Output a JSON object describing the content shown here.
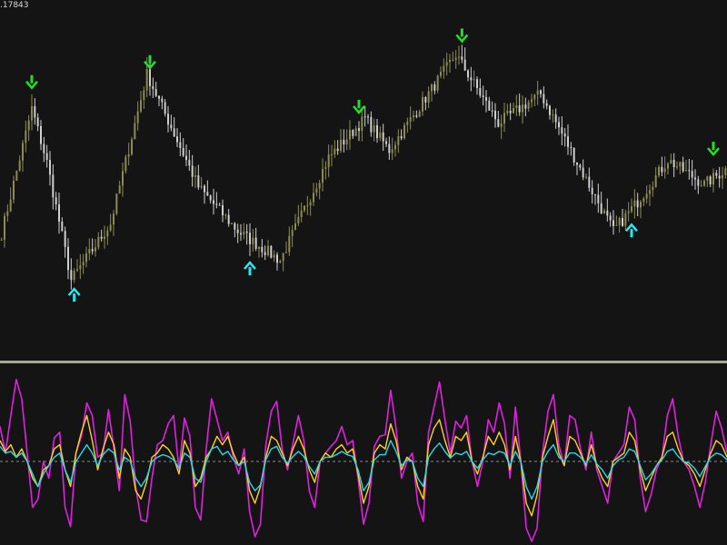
{
  "price_panel": {
    "corner_price_label": ".17843"
  },
  "colors": {
    "background": "#141414",
    "up_bar": "#8c8c52",
    "down_bar": "#cfcfcf",
    "sell_arrow": "#22e02a",
    "buy_arrow": "#2ce6f0",
    "osc_magenta": "#e020e0",
    "osc_yellow": "#ffd21a",
    "osc_cyan": "#28d8f0",
    "divider": "#a8a890",
    "zero_line": "#8a8a8a"
  },
  "chart_data": [
    {
      "type": "candlestick",
      "title": "",
      "xlabel": "",
      "ylabel": "",
      "ylim": [
        0,
        1
      ],
      "grid": false,
      "bars": 240,
      "pivots": [
        [
          0,
          0.27
        ],
        [
          10,
          0.78
        ],
        [
          15,
          0.56
        ],
        [
          23,
          0.08
        ],
        [
          36,
          0.31
        ],
        [
          48,
          0.92
        ],
        [
          65,
          0.46
        ],
        [
          78,
          0.28
        ],
        [
          92,
          0.16
        ],
        [
          108,
          0.58
        ],
        [
          120,
          0.74
        ],
        [
          128,
          0.61
        ],
        [
          150,
          1.0
        ],
        [
          164,
          0.72
        ],
        [
          178,
          0.84
        ],
        [
          190,
          0.56
        ],
        [
          202,
          0.28
        ],
        [
          210,
          0.4
        ],
        [
          220,
          0.57
        ],
        [
          232,
          0.47
        ],
        [
          240,
          0.54
        ]
      ],
      "signals": [
        {
          "bar": 10,
          "type": "sell"
        },
        {
          "bar": 49,
          "type": "sell"
        },
        {
          "bar": 118,
          "type": "sell"
        },
        {
          "bar": 152,
          "type": "sell"
        },
        {
          "bar": 235,
          "type": "sell"
        },
        {
          "bar": 24,
          "type": "buy"
        },
        {
          "bar": 82,
          "type": "buy"
        },
        {
          "bar": 208,
          "type": "buy"
        }
      ]
    },
    {
      "type": "line",
      "title": "",
      "xlabel": "",
      "ylabel": "",
      "ylim": [
        -1,
        1
      ],
      "zero_line": "dashed",
      "series": [
        {
          "color": "#e020e0",
          "values": [
            0.42,
            0.1,
            0.55,
            0.98,
            0.75,
            0.1,
            -0.55,
            -0.45,
            0.0,
            -0.2,
            0.28,
            0.35,
            -0.55,
            -0.78,
            0.1,
            0.3,
            0.7,
            0.55,
            0.05,
            0.1,
            0.62,
            0.15,
            -0.35,
            0.8,
            0.48,
            -0.3,
            -0.7,
            -0.72,
            -0.2,
            0.2,
            0.25,
            0.45,
            0.55,
            -0.1,
            0.52,
            0.3,
            -0.55,
            -0.7,
            0.15,
            0.75,
            0.5,
            0.25,
            0.35,
            0.05,
            -0.15,
            0.15,
            -0.6,
            -0.9,
            -0.75,
            0.2,
            0.6,
            0.72,
            0.15,
            -0.1,
            0.22,
            0.55,
            0.25,
            -0.35,
            -0.55,
            0.0,
            0.1,
            0.18,
            0.25,
            0.42,
            0.2,
            0.25,
            -0.2,
            -0.75,
            -0.5,
            0.18,
            0.3,
            0.32,
            0.85,
            0.4,
            -0.2,
            0.0,
            0.1,
            -0.5,
            -0.72,
            0.35,
            0.65,
            0.95,
            0.5,
            0.1,
            0.48,
            0.4,
            0.55,
            0.0,
            -0.3,
            0.0,
            0.5,
            0.35,
            0.7,
            0.45,
            -0.2,
            0.65,
            0.0,
            -0.8,
            -1.1,
            -0.8,
            0.1,
            0.6,
            0.8,
            0.2,
            -0.05,
            0.55,
            0.5,
            0.15,
            -0.1,
            0.35,
            -0.1,
            -0.3,
            -0.5,
            0.0,
            0.1,
            0.2,
            0.65,
            0.5,
            -0.2,
            -0.6,
            -0.4,
            -0.1,
            0.05,
            0.55,
            0.75,
            0.3,
            0.0,
            -0.1,
            -0.3,
            -0.55,
            -0.25,
            0.2,
            0.6,
            0.4,
            0.1
          ]
        },
        {
          "color": "#ffd21a",
          "values": [
            0.25,
            0.12,
            0.2,
            0.05,
            0.15,
            0.0,
            -0.2,
            -0.3,
            -0.1,
            -0.05,
            0.15,
            0.2,
            -0.1,
            -0.3,
            0.1,
            0.35,
            0.55,
            0.25,
            -0.1,
            0.15,
            0.35,
            0.2,
            -0.2,
            0.15,
            0.05,
            -0.35,
            -0.45,
            -0.25,
            0.05,
            0.1,
            0.2,
            0.15,
            0.05,
            -0.15,
            0.25,
            0.1,
            -0.3,
            -0.2,
            0.05,
            0.15,
            0.3,
            0.2,
            0.3,
            0.1,
            -0.05,
            0.05,
            -0.35,
            -0.5,
            -0.3,
            0.05,
            0.3,
            0.25,
            0.1,
            -0.05,
            0.15,
            0.3,
            0.15,
            -0.1,
            -0.25,
            0.0,
            0.1,
            0.05,
            0.15,
            0.2,
            0.1,
            0.15,
            -0.15,
            -0.5,
            -0.3,
            0.1,
            0.2,
            0.15,
            0.45,
            0.25,
            -0.1,
            0.05,
            0.0,
            -0.3,
            -0.45,
            0.2,
            0.4,
            0.5,
            0.25,
            0.05,
            0.3,
            0.25,
            0.35,
            0.0,
            -0.15,
            0.05,
            0.3,
            0.2,
            0.35,
            0.2,
            -0.1,
            0.3,
            0.0,
            -0.5,
            -0.65,
            -0.4,
            0.05,
            0.3,
            0.5,
            0.1,
            -0.05,
            0.3,
            0.25,
            0.1,
            -0.05,
            0.2,
            -0.05,
            -0.2,
            -0.3,
            0.0,
            0.05,
            0.1,
            0.35,
            0.25,
            -0.1,
            -0.35,
            -0.2,
            -0.05,
            0.05,
            0.3,
            0.35,
            0.15,
            0.0,
            -0.05,
            -0.15,
            -0.3,
            -0.1,
            0.1,
            0.25,
            0.2,
            0.05
          ]
        },
        {
          "color": "#28d8f0",
          "values": [
            0.18,
            0.1,
            0.12,
            0.05,
            0.1,
            0.0,
            -0.15,
            -0.3,
            -0.15,
            -0.05,
            0.05,
            0.1,
            -0.1,
            -0.25,
            0.0,
            0.1,
            0.2,
            0.1,
            -0.05,
            0.08,
            0.15,
            0.1,
            -0.1,
            0.05,
            0.0,
            -0.2,
            -0.3,
            -0.2,
            0.0,
            0.05,
            0.08,
            0.06,
            0.02,
            -0.08,
            0.1,
            0.05,
            -0.2,
            -0.25,
            0.0,
            0.15,
            0.18,
            0.08,
            0.12,
            0.02,
            -0.05,
            0.0,
            -0.25,
            -0.35,
            -0.28,
            0.02,
            0.15,
            0.18,
            0.05,
            -0.02,
            0.06,
            0.12,
            0.06,
            -0.06,
            -0.15,
            0.0,
            0.05,
            0.05,
            0.08,
            0.12,
            0.08,
            0.06,
            -0.1,
            -0.35,
            -0.25,
            0.02,
            0.08,
            0.08,
            0.25,
            0.12,
            -0.05,
            0.02,
            0.0,
            -0.2,
            -0.3,
            0.05,
            0.15,
            0.22,
            0.12,
            0.04,
            0.1,
            0.08,
            0.12,
            0.0,
            -0.08,
            0.02,
            0.1,
            0.08,
            0.12,
            0.1,
            -0.05,
            0.12,
            0.0,
            -0.3,
            -0.45,
            -0.3,
            0.0,
            0.12,
            0.2,
            0.05,
            0.0,
            0.1,
            0.1,
            0.05,
            -0.03,
            0.08,
            -0.03,
            -0.1,
            -0.2,
            -0.05,
            0.02,
            0.05,
            0.15,
            0.12,
            -0.05,
            -0.22,
            -0.15,
            -0.05,
            0.02,
            0.12,
            0.15,
            0.06,
            0.0,
            -0.02,
            -0.08,
            -0.18,
            -0.06,
            0.05,
            0.1,
            0.08,
            0.02
          ]
        }
      ]
    }
  ]
}
